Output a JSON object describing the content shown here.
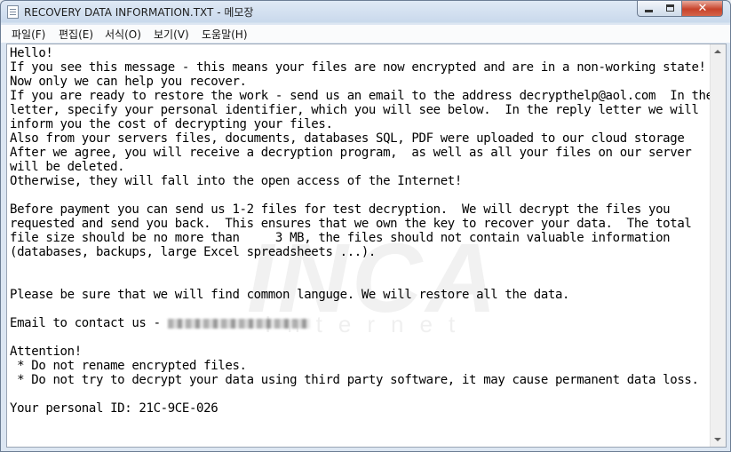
{
  "window": {
    "title": "RECOVERY DATA INFORMATION.TXT - 메모장",
    "close_glyph": "✕"
  },
  "menu": [
    {
      "label": "파일(F)"
    },
    {
      "label": "편집(E)"
    },
    {
      "label": "서식(O)"
    },
    {
      "label": "보기(V)"
    },
    {
      "label": "도움말(H)"
    }
  ],
  "note": {
    "lines": [
      "Hello!",
      "If you see this message - this means your files are now encrypted and are in a non-working state!",
      "Now only we can help you recover.",
      "If you are ready to restore the work - send us an email to the address decrypthelp@aol.com  In the",
      "letter, specify your personal identifier, which you will see below.  In the reply letter we will",
      "inform you the cost of decrypting your files.",
      "Also from your servers files, documents, databases SQL, PDF were uploaded to our cloud storage",
      "After we agree, you will receive a decryption program,  as well as all your files on our server",
      "will be deleted.",
      "Otherwise, they will fall into the open access of the Internet!",
      "",
      "Before payment you can send us 1-2 files for test decryption.  We will decrypt the files you",
      "requested and send you back.  This ensures that we own the key to recover your data.  The total",
      "file size should be no more than     3 MB, the files should not contain valuable information",
      "(databases, backups, large Excel spreadsheets ...).",
      "",
      "",
      "Please be sure that we will find common languge. We will restore all the data.",
      "",
      "Email to contact us - ",
      "",
      "Attention!",
      " * Do not rename encrypted files.",
      " * Do not try to decrypt your data using third party software, it may cause permanent data loss.",
      "",
      "Your personal ID: 21C-9CE-026"
    ]
  },
  "watermark": {
    "text": "INCA",
    "sub": "Internet"
  }
}
